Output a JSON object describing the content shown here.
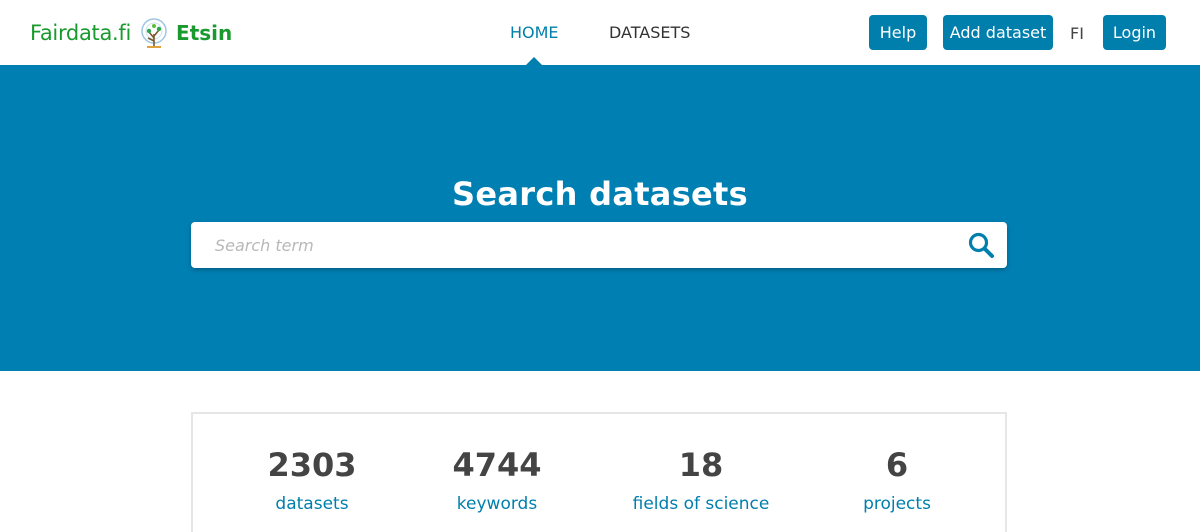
{
  "header": {
    "logo_text": "Fairdata.fi",
    "logo_app": "Etsin",
    "nav": {
      "home": "HOME",
      "datasets": "DATASETS"
    },
    "buttons": {
      "help": "Help",
      "add_dataset": "Add dataset",
      "login": "Login"
    },
    "language": "FI"
  },
  "hero": {
    "title": "Search datasets",
    "search_placeholder": "Search term"
  },
  "stats": [
    {
      "value": "2303",
      "label": "datasets"
    },
    {
      "value": "4744",
      "label": "keywords"
    },
    {
      "value": "18",
      "label": "fields of science"
    },
    {
      "value": "6",
      "label": "projects"
    }
  ],
  "colors": {
    "brand_green": "#1a9a2e",
    "primary_blue": "#007fad",
    "hero_blue": "#007fb3"
  },
  "icons": {
    "logo": "tree-logo-icon",
    "search": "search-icon"
  }
}
